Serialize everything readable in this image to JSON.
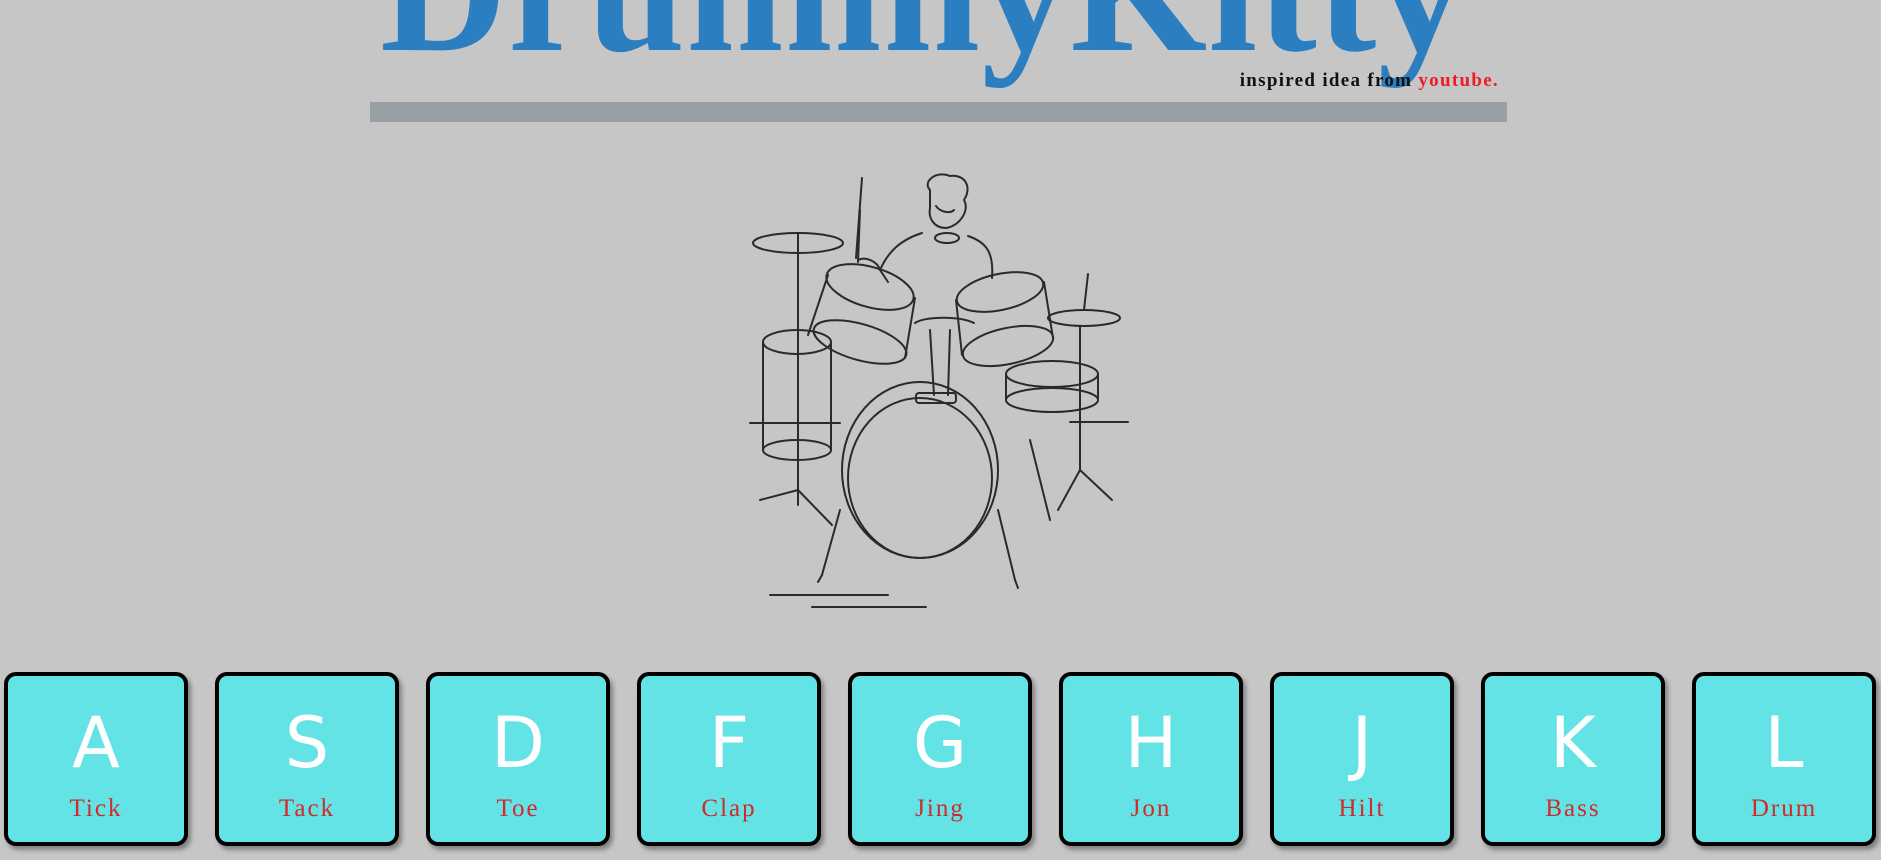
{
  "header": {
    "title": "DrummyKitty",
    "credit_text": "inspired idea from",
    "credit_link": "youtube."
  },
  "colors": {
    "background": "#c7c6c7",
    "title": "#2b7ec0",
    "link": "#ee1c25",
    "key_face": "#63e3e5",
    "key_label": "#d12a2a"
  },
  "illustration": {
    "name": "drummer-with-drum-kit",
    "style": "line-art"
  },
  "keys": [
    {
      "letter": "A",
      "sound": "Tick"
    },
    {
      "letter": "S",
      "sound": "Tack"
    },
    {
      "letter": "D",
      "sound": "Toe"
    },
    {
      "letter": "F",
      "sound": "Clap"
    },
    {
      "letter": "G",
      "sound": "Jing"
    },
    {
      "letter": "H",
      "sound": "Jon"
    },
    {
      "letter": "J",
      "sound": "Hilt"
    },
    {
      "letter": "K",
      "sound": "Bass"
    },
    {
      "letter": "L",
      "sound": "Drum"
    }
  ]
}
